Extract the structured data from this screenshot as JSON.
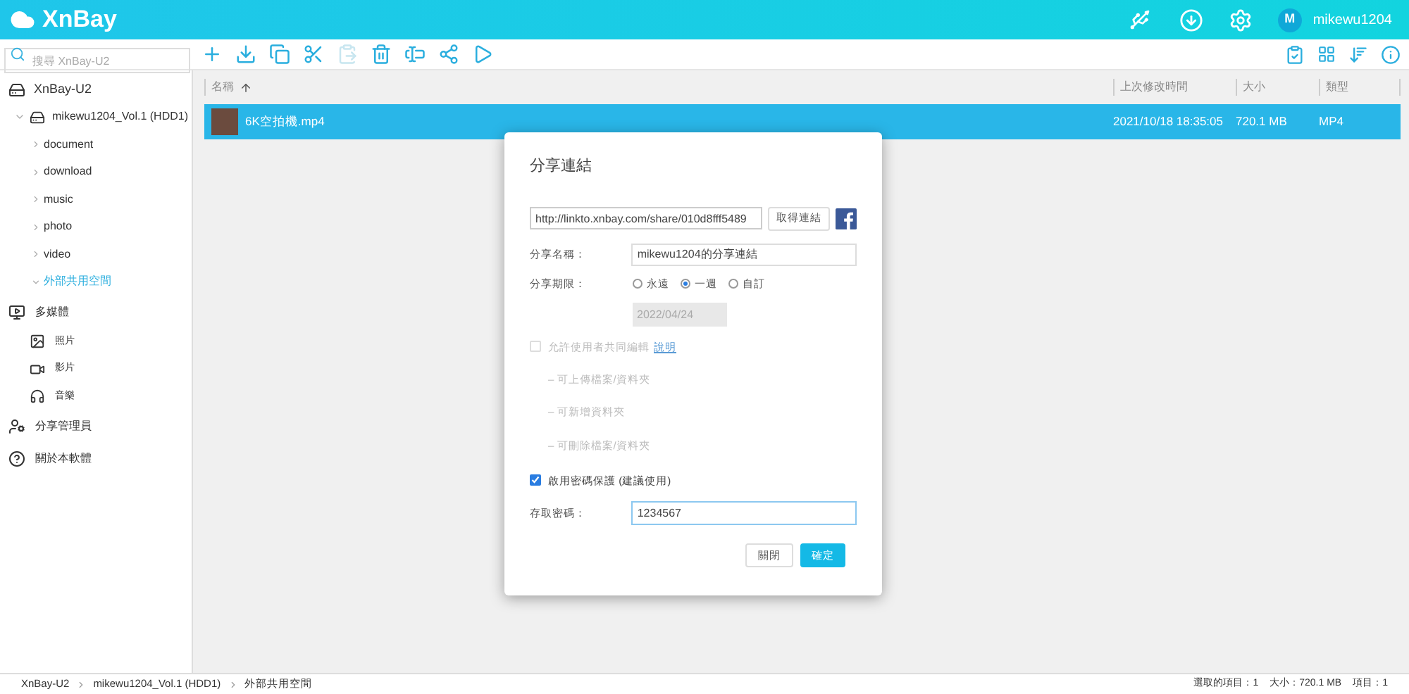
{
  "header": {
    "logo": "XnBay",
    "username": "mikewu1204",
    "avatar_initial": "M"
  },
  "search": {
    "placeholder": "搜尋 XnBay-U2"
  },
  "toolbar": [
    {
      "kind": "add",
      "disabled": false
    },
    {
      "kind": "download",
      "disabled": false
    },
    {
      "kind": "copy",
      "disabled": false
    },
    {
      "kind": "cut",
      "disabled": false
    },
    {
      "kind": "paste",
      "disabled": true
    },
    {
      "kind": "delete",
      "disabled": false
    },
    {
      "kind": "rename",
      "disabled": false
    },
    {
      "kind": "share",
      "disabled": false
    },
    {
      "kind": "play",
      "disabled": false
    }
  ],
  "sidebar": {
    "device": "XnBay-U2",
    "volume": {
      "label": "mikewu1204_Vol.1 (HDD1)",
      "expanded": true,
      "children": [
        {
          "label": "document",
          "expanded": false,
          "selected": false
        },
        {
          "label": "download",
          "expanded": false,
          "selected": false
        },
        {
          "label": "music",
          "expanded": false,
          "selected": false
        },
        {
          "label": "photo",
          "expanded": false,
          "selected": false
        },
        {
          "label": "video",
          "expanded": false,
          "selected": false
        },
        {
          "label": "外部共用空間",
          "expanded": true,
          "selected": true
        }
      ]
    },
    "sections": [
      {
        "kind": "media",
        "label": "多媒體",
        "children": [
          {
            "kind": "photo",
            "label": "照片"
          },
          {
            "kind": "video",
            "label": "影片"
          },
          {
            "kind": "music",
            "label": "音樂"
          }
        ]
      },
      {
        "kind": "share",
        "label": "分享管理員"
      },
      {
        "kind": "about",
        "label": "關於本軟體"
      }
    ]
  },
  "table": {
    "columns": [
      "名稱",
      "上次修改時間",
      "大小",
      "類型"
    ],
    "rows": [
      {
        "name": "6K空拍機.mp4",
        "modified": "2021/10/18 18:35:05",
        "size": "720.1 MB",
        "type": "MP4",
        "selected": true
      }
    ]
  },
  "dialog": {
    "title": "分享連結",
    "link": "http://linkto.xnbay.com/share/010d8fff5489",
    "get_link_button": "取得連結",
    "name_label": "分享名稱：",
    "name_value": "mikewu1204的分享連結",
    "period_label": "分享期限：",
    "periods": [
      {
        "label": "永遠",
        "selected": false
      },
      {
        "label": "一週",
        "selected": true
      },
      {
        "label": "自訂",
        "selected": false
      }
    ],
    "date": "2022/04/24",
    "date_disabled": true,
    "collab": {
      "label": "允許使用者共同編輯",
      "link": "說明",
      "checked": false,
      "disabled": true
    },
    "collab_options": [
      {
        "label": "– 可上傳檔案/資料夾",
        "disabled": true
      },
      {
        "label": "– 可新增資料夾",
        "disabled": true
      },
      {
        "label": "– 可刪除檔案/資料夾",
        "disabled": true
      }
    ],
    "password_protect": {
      "label": "啟用密碼保護 (建議使用)",
      "checked": true
    },
    "password_label": "存取密碼：",
    "password_value": "1234567",
    "buttons": [
      {
        "label": "關閉",
        "kind": "secondary"
      },
      {
        "label": "確定",
        "kind": "primary"
      }
    ]
  },
  "breadcrumb": [
    "XnBay-U2",
    "mikewu1204_Vol.1 (HDD1)",
    "外部共用空間"
  ],
  "status": [
    "選取的項目：1",
    "大小：720.1 MB",
    "項目：1"
  ]
}
